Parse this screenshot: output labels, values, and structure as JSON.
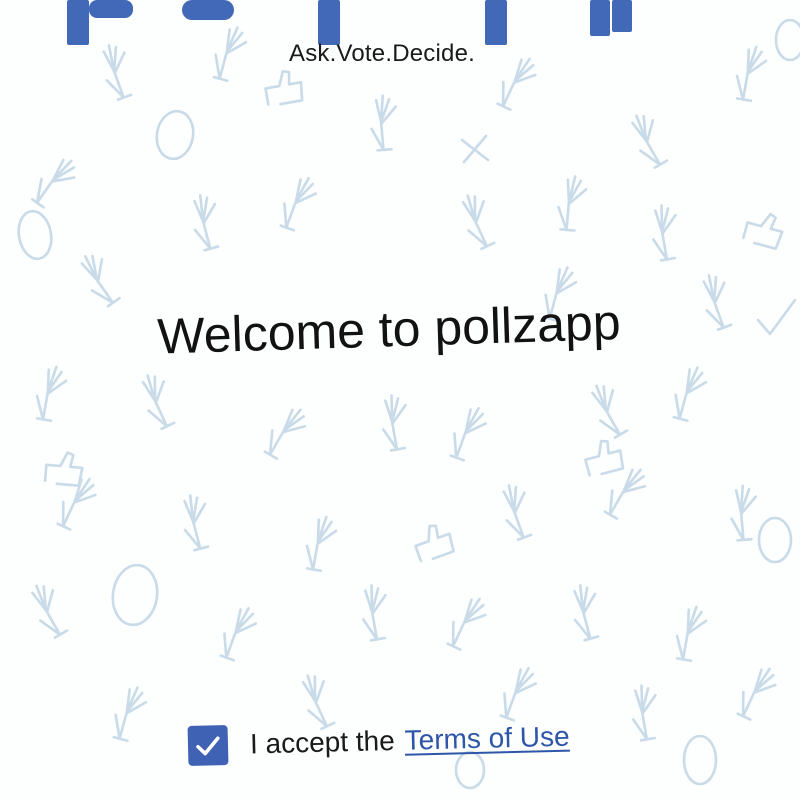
{
  "app": {
    "name": "pollzapp",
    "brand_color": "#4169b8",
    "tagline": "Ask.Vote.Decide."
  },
  "main": {
    "welcome_title": "Welcome to pollzapp"
  },
  "terms": {
    "accepted": true,
    "prefix_text": "I accept the",
    "link_label": "Terms of Use",
    "checkbox_color": "#3f62b4",
    "link_color": "#2e56a8"
  },
  "background": {
    "pattern_color": "#c9dbe8",
    "pattern_icons": [
      "raised-hand-icon",
      "thumbs-up-icon",
      "egg-icon",
      "cross-mark-icon",
      "check-mark-icon"
    ]
  }
}
